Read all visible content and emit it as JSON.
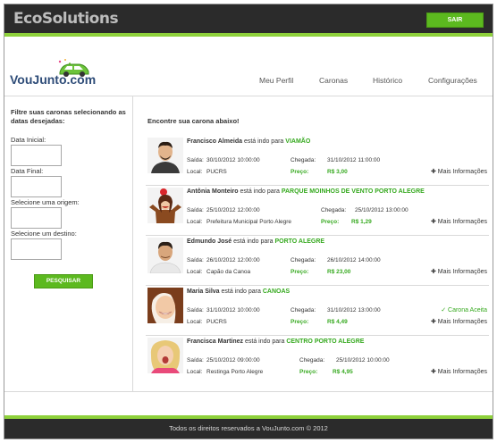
{
  "header": {
    "brand": "EcoSolutions",
    "logout_label": "SAIR",
    "accent_color": "#8ed13b"
  },
  "logo": {
    "text": "VouJunto.com"
  },
  "nav": {
    "items": [
      {
        "label": "Meu Perfil"
      },
      {
        "label": "Caronas"
      },
      {
        "label": "Histórico"
      },
      {
        "label": "Configurações"
      }
    ]
  },
  "sidebar": {
    "title": "Filtre suas caronas selecionando as datas desejadas:",
    "start_date_label": "Data Inicial:",
    "end_date_label": "Data Final:",
    "origin_label": "Selecione uma origem:",
    "destination_label": "Selecione um destino:",
    "search_button": "PESQUISAR"
  },
  "main": {
    "title": "Encontre sua carona abaixo!",
    "rides": [
      {
        "name": "Francisco Almeida",
        "phrase": "está indo para",
        "destination": "VIAMÃO",
        "saida_label": "Saída:",
        "saida": "30/10/2012 10:00:00",
        "chegada_label": "Chegada:",
        "chegada": "31/10/2012 11:00:00",
        "local_label": "Local:",
        "local": "PUCRS",
        "preco_label": "Preço:",
        "preco": "R$ 3,00",
        "more": "Mais Informações",
        "status": ""
      },
      {
        "name": "Antônia Monteiro",
        "phrase": "está indo para",
        "destination": "PARQUE MOINHOS DE VENTO PORTO ALEGRE",
        "saida_label": "Saída:",
        "saida": "25/10/2012 12:00:00",
        "chegada_label": "Chegada:",
        "chegada": "25/10/2012 13:00:00",
        "local_label": "Local:",
        "local": "Prefeitura Municipal Porto Alegre",
        "preco_label": "Preço:",
        "preco": "R$ 1,29",
        "more": "Mais Informações",
        "status": ""
      },
      {
        "name": "Edmundo José",
        "phrase": "está indo para",
        "destination": "PORTO ALEGRE",
        "saida_label": "Saída:",
        "saida": "26/10/2012 12:00:00",
        "chegada_label": "Chegada:",
        "chegada": "26/10/2012 14:00:00",
        "local_label": "Local:",
        "local": "Capão da Canoa",
        "preco_label": "Preço:",
        "preco": "R$ 23,00",
        "more": "Mais Informações",
        "status": ""
      },
      {
        "name": "Maria Silva",
        "phrase": "está indo para",
        "destination": "CANOAS",
        "saida_label": "Saída:",
        "saida": "31/10/2012 10:00:00",
        "chegada_label": "Chegada:",
        "chegada": "31/10/2012 13:00:00",
        "local_label": "Local:",
        "local": "PUCRS",
        "preco_label": "Preço:",
        "preco": "R$ 4,49",
        "more": "Mais Informações",
        "status": "Carona Aceita"
      },
      {
        "name": "Francisca Martinez",
        "phrase": "está indo para",
        "destination": "CENTRO PORTO ALEGRE",
        "saida_label": "Saída:",
        "saida": "25/10/2012 09:00:00",
        "chegada_label": "Chegada:",
        "chegada": "25/10/2012 10:00:00",
        "local_label": "Local:",
        "local": "Restinga Porto Alegre",
        "preco_label": "Preço:",
        "preco": "R$ 4,95",
        "more": "Mais Informações",
        "status": ""
      }
    ]
  },
  "footer": {
    "text": "Todos os direitos reservados a VouJunto.com © 2012"
  }
}
